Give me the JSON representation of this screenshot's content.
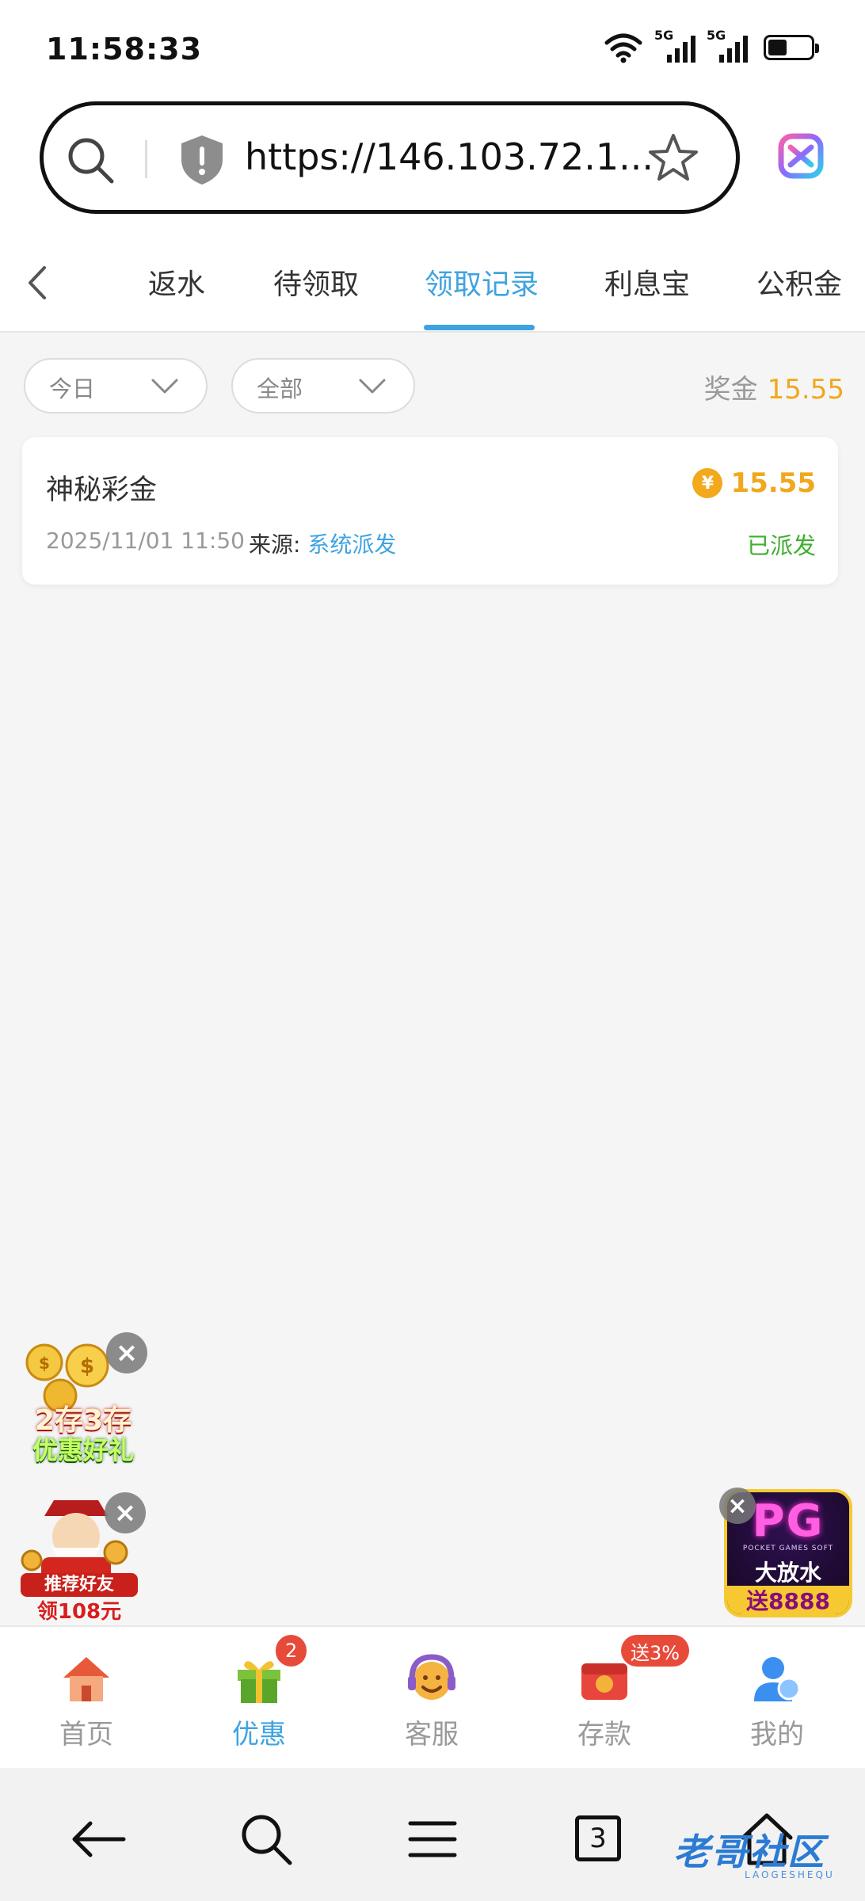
{
  "status_bar": {
    "time": "11:58:33",
    "network_1": "5G",
    "network_2": "5G",
    "battery_level": 0.45
  },
  "browser": {
    "url": "https://146.103.72.1...",
    "icons": [
      "search-icon",
      "shield-icon",
      "star-icon",
      "browser-logo-icon"
    ]
  },
  "tabs": {
    "items": [
      {
        "label": "返水",
        "active": false
      },
      {
        "label": "待领取",
        "active": false
      },
      {
        "label": "领取记录",
        "active": true
      },
      {
        "label": "利息宝",
        "active": false
      },
      {
        "label": "公积金",
        "active": false
      }
    ],
    "accent_color": "#3fa3e0"
  },
  "filters": {
    "date": "今日",
    "type": "全部",
    "bonus_label": "奖金",
    "bonus_value": "15.55"
  },
  "records": [
    {
      "title": "神秘彩金",
      "amount": "15.55",
      "coin_symbol": "¥",
      "date": "2025/11/01 11:50",
      "source_label": "来源:",
      "source_value": "系统派发",
      "status": "已派发"
    }
  ],
  "promos": {
    "promo1_line1": "2存3存",
    "promo1_line2": "优惠好礼",
    "promo2_line1": "推荐好友",
    "promo2_line2": "领108元",
    "pg_logo": "PG",
    "pg_small": "POCKET GAMES SOFT",
    "pg_line1": "大放水",
    "pg_line2": "送8888",
    "close_symbol": "×"
  },
  "bottom_nav": {
    "items": [
      {
        "label": "首页",
        "icon": "home-icon",
        "active": false
      },
      {
        "label": "优惠",
        "icon": "gift-icon",
        "active": true,
        "badge": "2"
      },
      {
        "label": "客服",
        "icon": "support-icon",
        "active": false
      },
      {
        "label": "存款",
        "icon": "wallet-icon",
        "active": false,
        "badge": "送3%"
      },
      {
        "label": "我的",
        "icon": "user-icon",
        "active": false
      }
    ]
  },
  "system_nav": {
    "tab_count": "3",
    "watermark": "老哥社区",
    "watermark_sub": "LAOGESHEQU"
  },
  "colors": {
    "accent": "#3fa3e0",
    "gold": "#f0a81c",
    "success": "#3fae2f",
    "badge_red": "#e84a3a"
  }
}
